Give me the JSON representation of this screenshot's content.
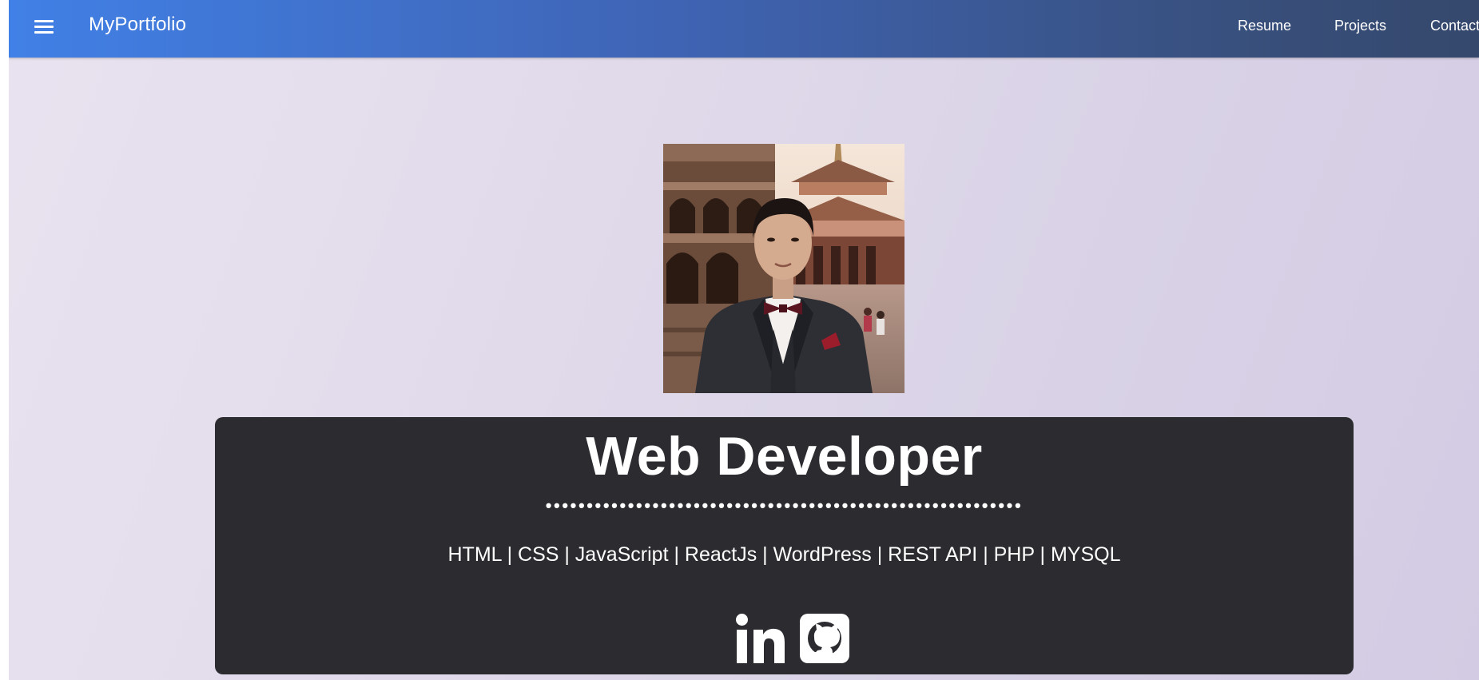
{
  "navbar": {
    "brand": "MyPortfolio",
    "links": [
      "Resume",
      "Projects",
      "Contact"
    ]
  },
  "hero": {
    "title": "Web Developer",
    "divider": "••••••••••••••••••••••••••••••••••••••••••••••••••••••••••",
    "skills": "HTML | CSS | JavaScript | ReactJs | WordPress | REST API | PHP | MYSQL"
  },
  "icons": {
    "menu": "hamburger-menu-icon",
    "linkedin": "linkedin-icon",
    "github": "github-icon"
  },
  "colors": {
    "navbar_start": "#4180e6",
    "navbar_end": "#35486c",
    "background": "#e2dcec",
    "card": "#2c2b30",
    "text_light": "#ffffff"
  }
}
